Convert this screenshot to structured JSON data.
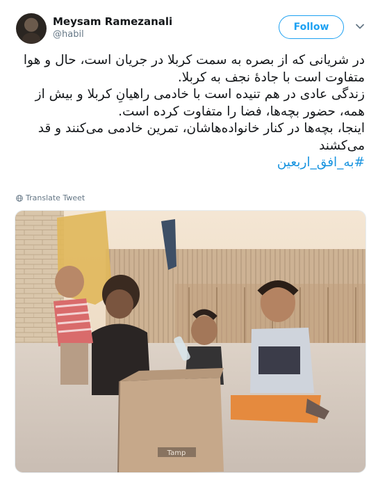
{
  "author": {
    "name": "Meysam Ramezanali",
    "handle": "@habil"
  },
  "follow_label": "Follow",
  "tweet": {
    "lines": [
      "در شریانی که از بصره به سمت کربلا در جریان است، حال و هوا متفاوت است با جادهٔ نجف به کربلا.",
      "زندگی عادی در هم تنیده است با خادمی راهیانِ کربلا و بیش از همه، حضور بچه‌ها، فضا را متفاوت کرده است.",
      "اینجا، بچه‌ها در کنار خانواده‌هاشان، تمرین خادمی می‌کنند و قد می‌کشند"
    ],
    "hashtag": "#به_افق_اربعین"
  },
  "translate_label": "Translate Tweet",
  "photo": {
    "box_print": "Tamp"
  },
  "icons": {
    "caret": "chevron-down-icon",
    "translate": "globe-icon"
  },
  "colors": {
    "accent": "#1da1f2",
    "hashtag": "#1b95e0",
    "secondary_text": "#657786"
  }
}
